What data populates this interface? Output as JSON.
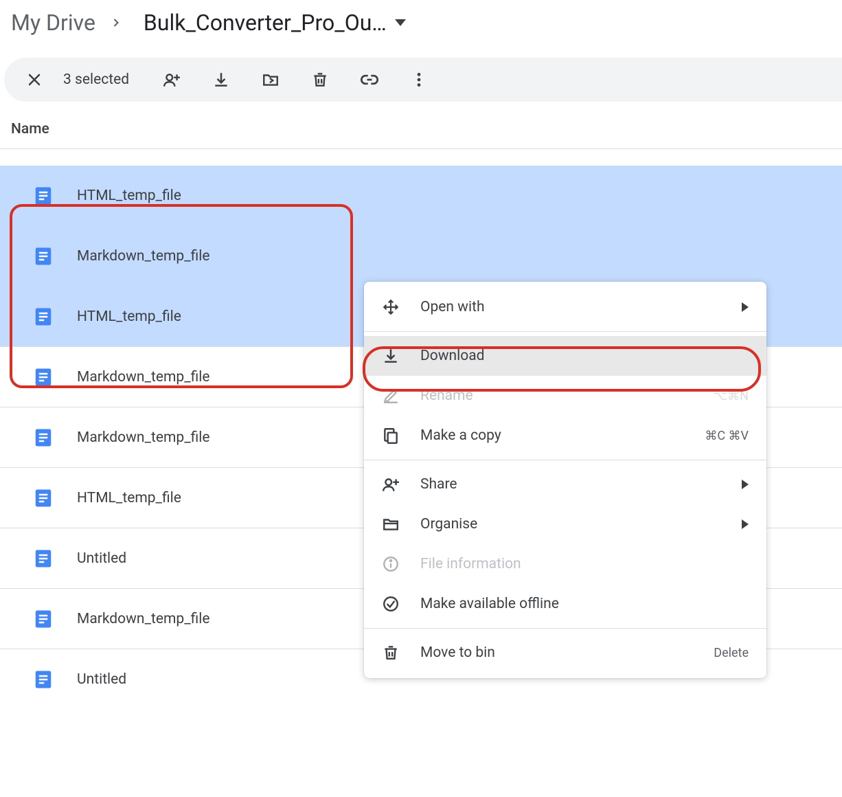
{
  "breadcrumb": {
    "root": "My Drive",
    "current": "Bulk_Converter_Pro_Ou…"
  },
  "selection": {
    "count_text": "3 selected"
  },
  "list": {
    "header": "Name",
    "files": [
      {
        "name": "HTML_temp_file",
        "selected": true
      },
      {
        "name": "Markdown_temp_file",
        "selected": true
      },
      {
        "name": "HTML_temp_file",
        "selected": true
      },
      {
        "name": "Markdown_temp_file",
        "selected": false
      },
      {
        "name": "Markdown_temp_file",
        "selected": false
      },
      {
        "name": "HTML_temp_file",
        "selected": false
      },
      {
        "name": "Untitled",
        "selected": false
      },
      {
        "name": "Markdown_temp_file",
        "selected": false
      },
      {
        "name": "Untitled",
        "selected": false
      }
    ]
  },
  "contextmenu": {
    "openwith": "Open with",
    "download": "Download",
    "rename": "Rename",
    "rename_short": "⌥⌘N",
    "makecopy": "Make a copy",
    "makecopy_short": "⌘C ⌘V",
    "share": "Share",
    "organise": "Organise",
    "fileinfo": "File information",
    "offline": "Make available offline",
    "movetobin": "Move to bin",
    "movetobin_short": "Delete"
  }
}
